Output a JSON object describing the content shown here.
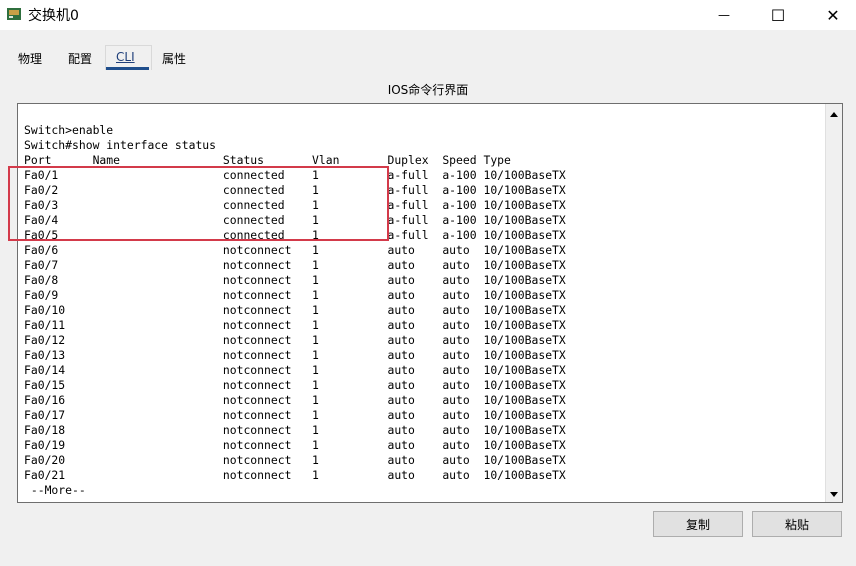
{
  "window": {
    "title": "交换机0",
    "min_glyph": "—",
    "max_glyph": "☐",
    "close_glyph": "✕"
  },
  "tabs": [
    {
      "label": "物理"
    },
    {
      "label": "配置"
    },
    {
      "label": "CLI"
    },
    {
      "label": "属性"
    }
  ],
  "header_label": "IOS命令行界面",
  "terminal": {
    "text": "Switch>enable\nSwitch#show interface status\nPort      Name               Status       Vlan       Duplex  Speed Type\nFa0/1                        connected    1          a-full  a-100 10/100BaseTX\nFa0/2                        connected    1          a-full  a-100 10/100BaseTX\nFa0/3                        connected    1          a-full  a-100 10/100BaseTX\nFa0/4                        connected    1          a-full  a-100 10/100BaseTX\nFa0/5                        connected    1          a-full  a-100 10/100BaseTX\nFa0/6                        notconnect   1          auto    auto  10/100BaseTX\nFa0/7                        notconnect   1          auto    auto  10/100BaseTX\nFa0/8                        notconnect   1          auto    auto  10/100BaseTX\nFa0/9                        notconnect   1          auto    auto  10/100BaseTX\nFa0/10                       notconnect   1          auto    auto  10/100BaseTX\nFa0/11                       notconnect   1          auto    auto  10/100BaseTX\nFa0/12                       notconnect   1          auto    auto  10/100BaseTX\nFa0/13                       notconnect   1          auto    auto  10/100BaseTX\nFa0/14                       notconnect   1          auto    auto  10/100BaseTX\nFa0/15                       notconnect   1          auto    auto  10/100BaseTX\nFa0/16                       notconnect   1          auto    auto  10/100BaseTX\nFa0/17                       notconnect   1          auto    auto  10/100BaseTX\nFa0/18                       notconnect   1          auto    auto  10/100BaseTX\nFa0/19                       notconnect   1          auto    auto  10/100BaseTX\nFa0/20                       notconnect   1          auto    auto  10/100BaseTX\nFa0/21                       notconnect   1          auto    auto  10/100BaseTX\n --More--"
  },
  "buttons": {
    "copy": "复制",
    "paste": "粘贴"
  },
  "colors": {
    "highlight": "#d33a4a",
    "tab_selected": "#1f4e8c"
  }
}
